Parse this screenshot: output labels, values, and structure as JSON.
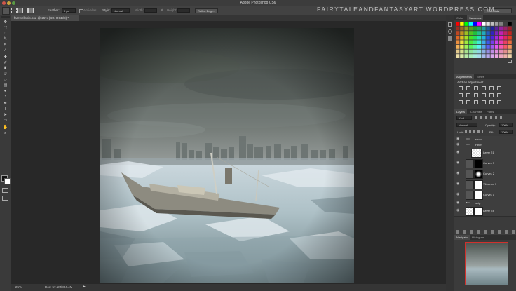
{
  "window": {
    "title": "Adobe Photoshop CS6",
    "watermark": "FAIRYTALEANDFANTASYART.WORDPRESS.COM",
    "workspace": "Essentials"
  },
  "options_bar": {
    "feather_label": "Feather:",
    "feather_value": "0 px",
    "antialias_label": "Anti-alias",
    "style_label": "Style:",
    "style_value": "Normal",
    "width_label": "Width:",
    "height_label": "Height:",
    "refine_label": "Refine Edge..."
  },
  "document": {
    "tab_label": "farewellship.psd @ 25% (BG, RGB/8) *",
    "zoom": "25%",
    "doc_size": "Doc: 57.1M/804.4M"
  },
  "panels": {
    "color_tabs": [
      "Color",
      "Swatches"
    ],
    "adjustments_tabs": [
      "Adjustments",
      "Styles"
    ],
    "adjustments_heading": "Add an adjustment",
    "layers_tabs": [
      "Layers",
      "Channels",
      "Paths"
    ],
    "kind_label": "Kind",
    "blend_mode": "Normal",
    "opacity_label": "Opacity:",
    "opacity_value": "100%",
    "lock_label": "Lock:",
    "fill_label": "Fill:",
    "fill_value": "100%",
    "layers": [
      {
        "name": "snow",
        "type": "group"
      },
      {
        "name": "Filter",
        "type": "group"
      },
      {
        "name": "Layer 21",
        "type": "pixel"
      },
      {
        "name": "Curves 3",
        "type": "adjustment"
      },
      {
        "name": "Curves 2",
        "type": "adjustment"
      },
      {
        "name": "Vibrance 1",
        "type": "adjustment"
      },
      {
        "name": "Curves 1",
        "type": "adjustment"
      },
      {
        "name": "ship",
        "type": "group"
      },
      {
        "name": "Layer 24",
        "type": "pixel"
      }
    ],
    "navigator_tabs": [
      "Navigator",
      "Histogram"
    ]
  },
  "tools": [
    "move",
    "marquee",
    "lasso",
    "quick-select",
    "crop",
    "eyedropper",
    "healing",
    "brush",
    "clone",
    "history-brush",
    "eraser",
    "gradient",
    "blur",
    "dodge",
    "pen",
    "type",
    "path-select",
    "shape",
    "hand",
    "zoom"
  ]
}
